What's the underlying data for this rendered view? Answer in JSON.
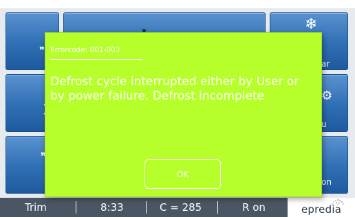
{
  "background_tiles": {
    "right_labels": [
      "ar",
      "u",
      "on"
    ]
  },
  "status_bar": {
    "items": [
      "Trim",
      "8:33",
      "C = 285",
      "R on"
    ]
  },
  "brand": {
    "name": "epredia"
  },
  "dialog": {
    "code": "Errorcode: 001-003",
    "message": "Defrost cycle interrupted either by User or by power failure. Defrost incomplete",
    "ok_label": "OK",
    "background_color": "#b6ff2a",
    "text_color": "#ffffff"
  }
}
